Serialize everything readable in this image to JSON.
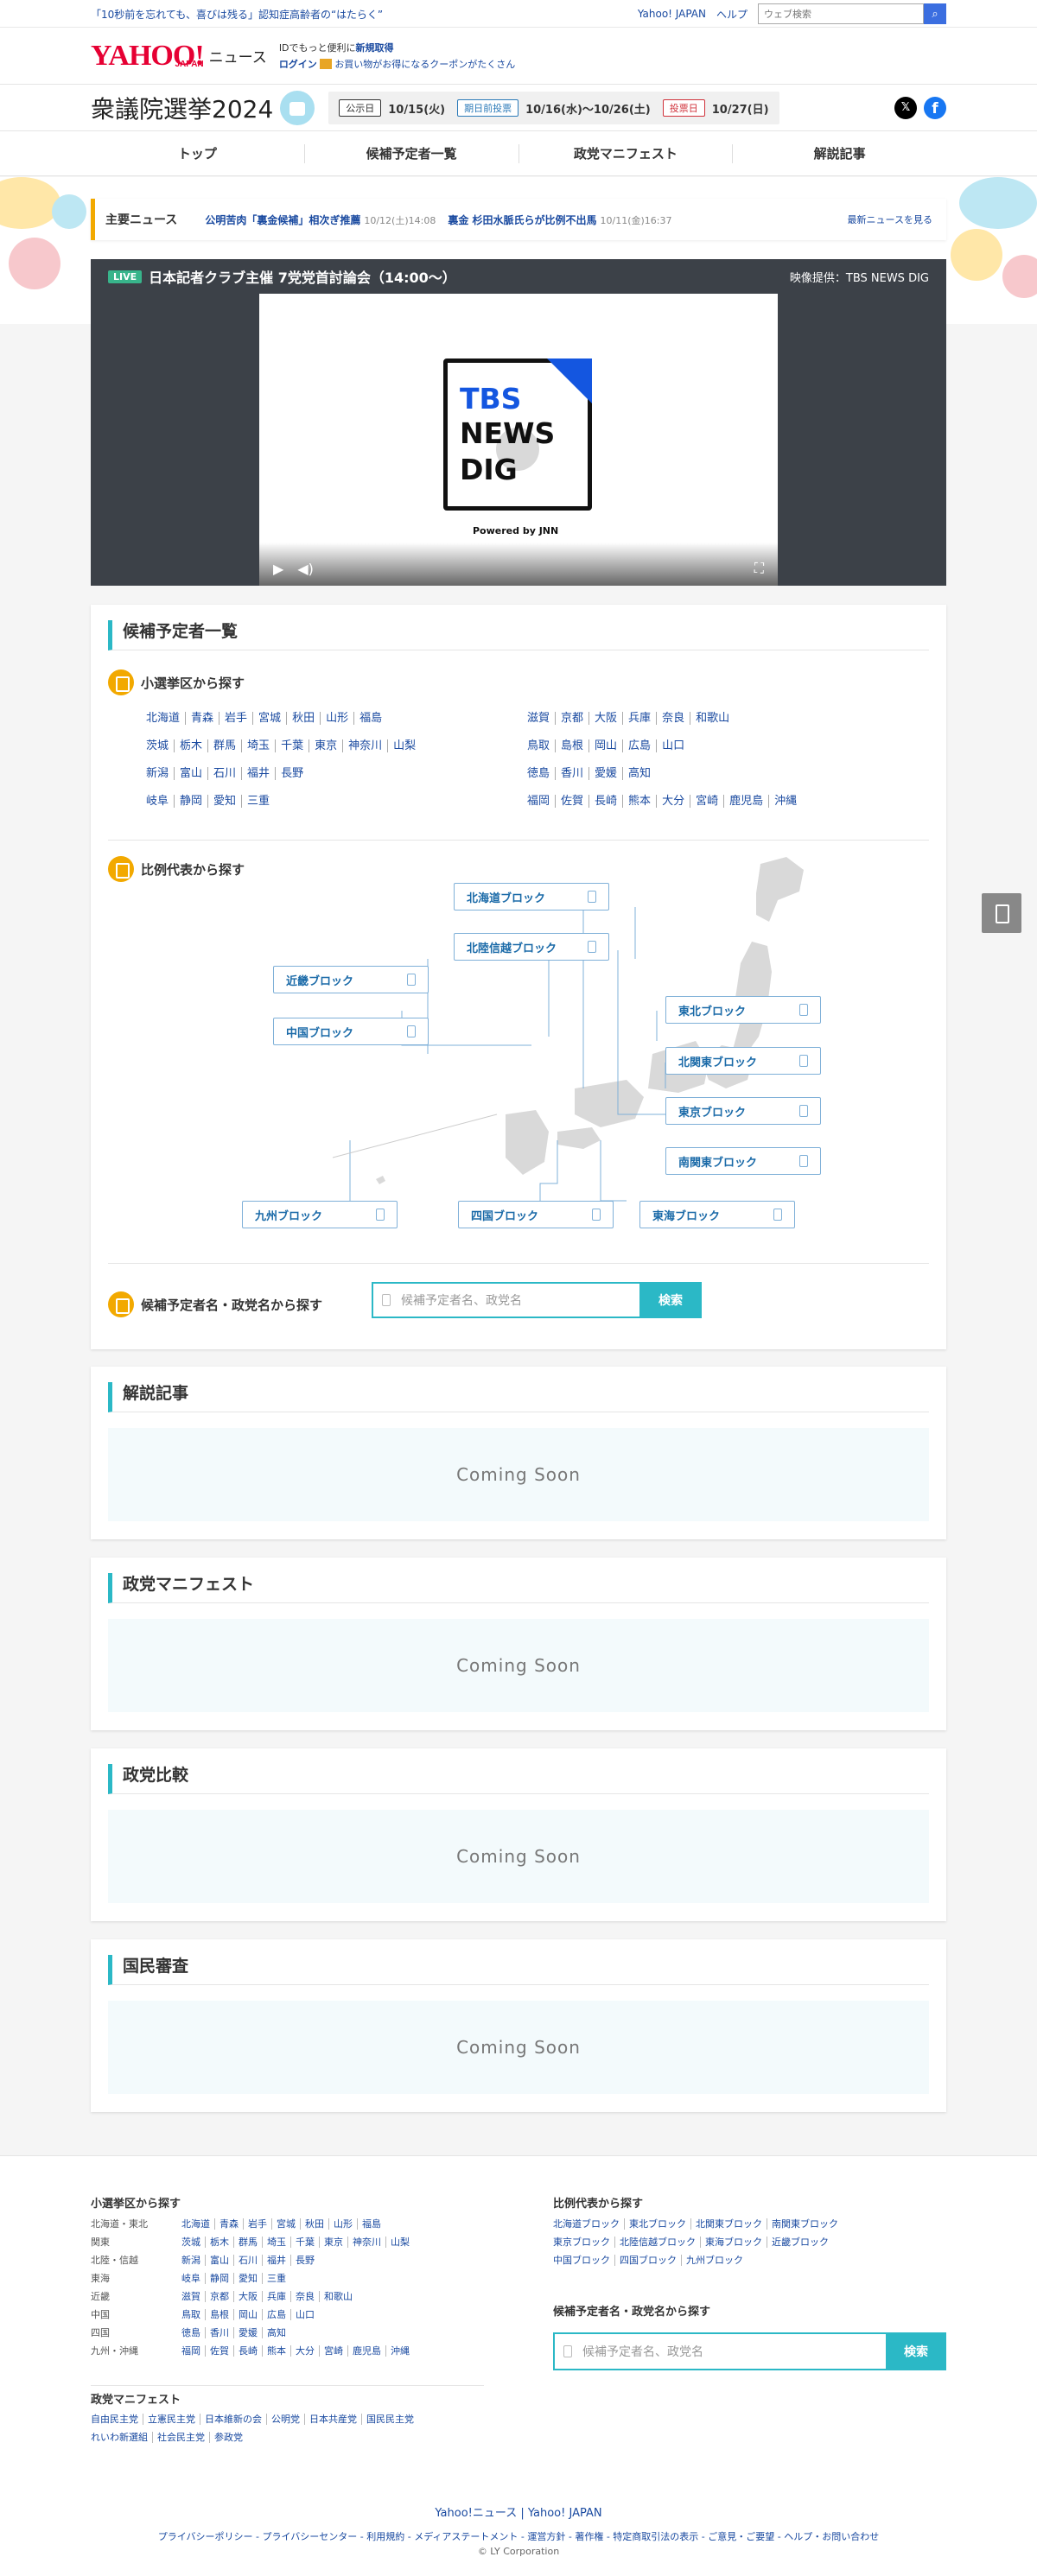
{
  "topbar": {
    "promo": "「10秒前を忘れても、喜びは残る」認知症高齢者の“はたらく”",
    "yahoo_japan": "Yahoo! JAPAN",
    "help": "ヘルプ",
    "search_placeholder": "ウェブ検索"
  },
  "header": {
    "logo_main": "YAHOO!",
    "logo_sub": "JAPAN",
    "logo_news": "ニュース",
    "id_text": "IDでもっと便利に",
    "register": "新規取得",
    "login": "ログイン",
    "coupon": "お買い物がお得になるクーポンがたくさん"
  },
  "election": {
    "title": "衆議院選挙2024",
    "dates": [
      {
        "tag": "公示日",
        "value": "10/15(火)"
      },
      {
        "tag": "期日前投票",
        "value": "10/16(水)〜10/26(土)"
      },
      {
        "tag": "投票日",
        "value": "10/27(日)"
      }
    ],
    "x_glyph": "𝕏",
    "fb_glyph": "f"
  },
  "nav": [
    "トップ",
    "候補予定者一覧",
    "政党マニフェスト",
    "解説記事"
  ],
  "news": {
    "label": "主要ニュース",
    "items": [
      {
        "title": "公明苦肉「裏金候補」相次ぎ推薦",
        "time": "10/12(土)14:08"
      },
      {
        "title": "裏金 杉田水脈氏らが比例不出馬",
        "time": "10/11(金)16:37"
      }
    ],
    "more": "最新ニュースを見る"
  },
  "live": {
    "tag": "LIVE",
    "title": "日本記者クラブ主催 7党党首討論会（14:00〜）",
    "provider": "映像提供：TBS NEWS DIG",
    "logo_l1": "TBS",
    "logo_l2": "NEWS",
    "logo_l3": "DIG",
    "powered": "Powered by JNN",
    "play_glyph": "▶",
    "vol_glyph": "◀)",
    "full_glyph": "⛶"
  },
  "candidates": {
    "heading": "候補予定者一覧",
    "by_district": "小選挙区から探す",
    "left_rows": [
      [
        "北海道",
        "青森",
        "岩手",
        "宮城",
        "秋田",
        "山形",
        "福島"
      ],
      [
        "茨城",
        "栃木",
        "群馬",
        "埼玉",
        "千葉",
        "東京",
        "神奈川",
        "山梨"
      ],
      [
        "新潟",
        "富山",
        "石川",
        "福井",
        "長野"
      ],
      [
        "岐阜",
        "静岡",
        "愛知",
        "三重"
      ]
    ],
    "right_rows": [
      [
        "滋賀",
        "京都",
        "大阪",
        "兵庫",
        "奈良",
        "和歌山"
      ],
      [
        "鳥取",
        "島根",
        "岡山",
        "広島",
        "山口"
      ],
      [
        "徳島",
        "香川",
        "愛媛",
        "高知"
      ],
      [
        "福岡",
        "佐賀",
        "長崎",
        "熊本",
        "大分",
        "宮崎",
        "鹿児島",
        "沖縄"
      ]
    ],
    "by_pr": "比例代表から探す",
    "blocks": {
      "hokkaido": "北海道ブロック",
      "hokuriku": "北陸信越ブロック",
      "kinki": "近畿ブロック",
      "chugoku": "中国ブロック",
      "tohoku": "東北ブロック",
      "kitakanto": "北関東ブロック",
      "tokyo": "東京ブロック",
      "minamikanto": "南関東ブロック",
      "kyushu": "九州ブロック",
      "shikoku": "四国ブロック",
      "tokai": "東海ブロック"
    },
    "by_name": "候補予定者名・政党名から探す",
    "search_placeholder": "候補予定者名、政党名",
    "search_button": "検索"
  },
  "sections": [
    {
      "heading": "解説記事",
      "body": "Coming Soon"
    },
    {
      "heading": "政党マニフェスト",
      "body": "Coming Soon"
    },
    {
      "heading": "政党比較",
      "body": "Coming Soon"
    },
    {
      "heading": "国民審査",
      "body": "Coming Soon"
    }
  ],
  "footer": {
    "district_heading": "小選挙区から探す",
    "district_rows": [
      {
        "region": "北海道・東北",
        "prefs": [
          "北海道",
          "青森",
          "岩手",
          "宮城",
          "秋田",
          "山形",
          "福島"
        ]
      },
      {
        "region": "関東",
        "prefs": [
          "茨城",
          "栃木",
          "群馬",
          "埼玉",
          "千葉",
          "東京",
          "神奈川",
          "山梨"
        ]
      },
      {
        "region": "北陸・信越",
        "prefs": [
          "新潟",
          "富山",
          "石川",
          "福井",
          "長野"
        ]
      },
      {
        "region": "東海",
        "prefs": [
          "岐阜",
          "静岡",
          "愛知",
          "三重"
        ]
      },
      {
        "region": "近畿",
        "prefs": [
          "滋賀",
          "京都",
          "大阪",
          "兵庫",
          "奈良",
          "和歌山"
        ]
      },
      {
        "region": "中国",
        "prefs": [
          "鳥取",
          "島根",
          "岡山",
          "広島",
          "山口"
        ]
      },
      {
        "region": "四国",
        "prefs": [
          "徳島",
          "香川",
          "愛媛",
          "高知"
        ]
      },
      {
        "region": "九州・沖縄",
        "prefs": [
          "福岡",
          "佐賀",
          "長崎",
          "熊本",
          "大分",
          "宮崎",
          "鹿児島",
          "沖縄"
        ]
      }
    ],
    "pr_heading": "比例代表から探す",
    "pr_rows": [
      [
        "北海道ブロック",
        "東北ブロック",
        "北関東ブロック",
        "南関東ブロック"
      ],
      [
        "東京ブロック",
        "北陸信越ブロック",
        "東海ブロック",
        "近畿ブロック"
      ],
      [
        "中国ブロック",
        "四国ブロック",
        "九州ブロック"
      ]
    ],
    "name_heading": "候補予定者名・政党名から探す",
    "search_placeholder": "候補予定者名、政党名",
    "search_button": "検索",
    "manifesto_heading": "政党マニフェスト",
    "party_rows": [
      [
        "自由民主党",
        "立憲民主党",
        "日本維新の会",
        "公明党",
        "日本共産党",
        "国民民主党"
      ],
      [
        "れいわ新選組",
        "社会民主党",
        "参政党"
      ]
    ],
    "brand": "Yahoo!ニュース | Yahoo! JAPAN",
    "legal": "プライバシーポリシー - プライバシーセンター - 利用規約 - メディアステートメント - 運営方針 - 著作権 - 特定商取引法の表示 - ご意見・ご要望 - ヘルプ・お問い合わせ",
    "copyright": "© LY Corporation"
  },
  "colors": {
    "accent": "#2bb8c6",
    "news_bar": "#f2a900",
    "brand_red": "#e60033",
    "link": "#1a4aa0"
  }
}
